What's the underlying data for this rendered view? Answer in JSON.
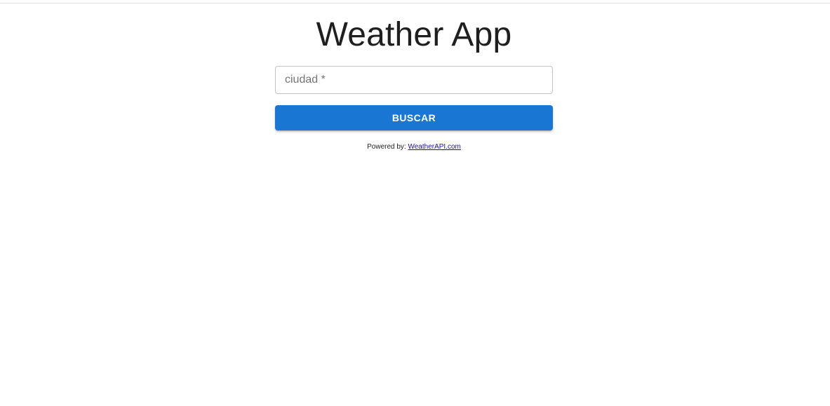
{
  "header": {
    "title": "Weather App"
  },
  "search": {
    "placeholder": "ciudad *",
    "value": ""
  },
  "actions": {
    "search_label": "BUSCAR"
  },
  "footer": {
    "powered_label": "Powered by: ",
    "link_text": "WeatherAPI.com"
  },
  "colors": {
    "button": "#1976d2",
    "button_text": "#ffffff",
    "link": "#1a0dab"
  }
}
